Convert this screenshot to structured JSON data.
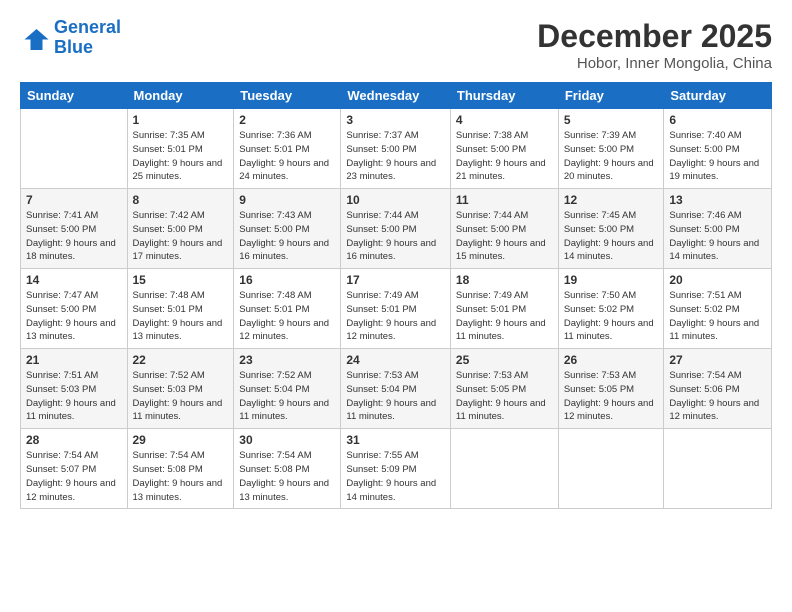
{
  "logo": {
    "line1": "General",
    "line2": "Blue"
  },
  "title": "December 2025",
  "location": "Hobor, Inner Mongolia, China",
  "header_days": [
    "Sunday",
    "Monday",
    "Tuesday",
    "Wednesday",
    "Thursday",
    "Friday",
    "Saturday"
  ],
  "weeks": [
    [
      {
        "day": "",
        "sunrise": "",
        "sunset": "",
        "daylight": ""
      },
      {
        "day": "1",
        "sunrise": "Sunrise: 7:35 AM",
        "sunset": "Sunset: 5:01 PM",
        "daylight": "Daylight: 9 hours and 25 minutes."
      },
      {
        "day": "2",
        "sunrise": "Sunrise: 7:36 AM",
        "sunset": "Sunset: 5:01 PM",
        "daylight": "Daylight: 9 hours and 24 minutes."
      },
      {
        "day": "3",
        "sunrise": "Sunrise: 7:37 AM",
        "sunset": "Sunset: 5:00 PM",
        "daylight": "Daylight: 9 hours and 23 minutes."
      },
      {
        "day": "4",
        "sunrise": "Sunrise: 7:38 AM",
        "sunset": "Sunset: 5:00 PM",
        "daylight": "Daylight: 9 hours and 21 minutes."
      },
      {
        "day": "5",
        "sunrise": "Sunrise: 7:39 AM",
        "sunset": "Sunset: 5:00 PM",
        "daylight": "Daylight: 9 hours and 20 minutes."
      },
      {
        "day": "6",
        "sunrise": "Sunrise: 7:40 AM",
        "sunset": "Sunset: 5:00 PM",
        "daylight": "Daylight: 9 hours and 19 minutes."
      }
    ],
    [
      {
        "day": "7",
        "sunrise": "Sunrise: 7:41 AM",
        "sunset": "Sunset: 5:00 PM",
        "daylight": "Daylight: 9 hours and 18 minutes."
      },
      {
        "day": "8",
        "sunrise": "Sunrise: 7:42 AM",
        "sunset": "Sunset: 5:00 PM",
        "daylight": "Daylight: 9 hours and 17 minutes."
      },
      {
        "day": "9",
        "sunrise": "Sunrise: 7:43 AM",
        "sunset": "Sunset: 5:00 PM",
        "daylight": "Daylight: 9 hours and 16 minutes."
      },
      {
        "day": "10",
        "sunrise": "Sunrise: 7:44 AM",
        "sunset": "Sunset: 5:00 PM",
        "daylight": "Daylight: 9 hours and 16 minutes."
      },
      {
        "day": "11",
        "sunrise": "Sunrise: 7:44 AM",
        "sunset": "Sunset: 5:00 PM",
        "daylight": "Daylight: 9 hours and 15 minutes."
      },
      {
        "day": "12",
        "sunrise": "Sunrise: 7:45 AM",
        "sunset": "Sunset: 5:00 PM",
        "daylight": "Daylight: 9 hours and 14 minutes."
      },
      {
        "day": "13",
        "sunrise": "Sunrise: 7:46 AM",
        "sunset": "Sunset: 5:00 PM",
        "daylight": "Daylight: 9 hours and 14 minutes."
      }
    ],
    [
      {
        "day": "14",
        "sunrise": "Sunrise: 7:47 AM",
        "sunset": "Sunset: 5:00 PM",
        "daylight": "Daylight: 9 hours and 13 minutes."
      },
      {
        "day": "15",
        "sunrise": "Sunrise: 7:48 AM",
        "sunset": "Sunset: 5:01 PM",
        "daylight": "Daylight: 9 hours and 13 minutes."
      },
      {
        "day": "16",
        "sunrise": "Sunrise: 7:48 AM",
        "sunset": "Sunset: 5:01 PM",
        "daylight": "Daylight: 9 hours and 12 minutes."
      },
      {
        "day": "17",
        "sunrise": "Sunrise: 7:49 AM",
        "sunset": "Sunset: 5:01 PM",
        "daylight": "Daylight: 9 hours and 12 minutes."
      },
      {
        "day": "18",
        "sunrise": "Sunrise: 7:49 AM",
        "sunset": "Sunset: 5:01 PM",
        "daylight": "Daylight: 9 hours and 11 minutes."
      },
      {
        "day": "19",
        "sunrise": "Sunrise: 7:50 AM",
        "sunset": "Sunset: 5:02 PM",
        "daylight": "Daylight: 9 hours and 11 minutes."
      },
      {
        "day": "20",
        "sunrise": "Sunrise: 7:51 AM",
        "sunset": "Sunset: 5:02 PM",
        "daylight": "Daylight: 9 hours and 11 minutes."
      }
    ],
    [
      {
        "day": "21",
        "sunrise": "Sunrise: 7:51 AM",
        "sunset": "Sunset: 5:03 PM",
        "daylight": "Daylight: 9 hours and 11 minutes."
      },
      {
        "day": "22",
        "sunrise": "Sunrise: 7:52 AM",
        "sunset": "Sunset: 5:03 PM",
        "daylight": "Daylight: 9 hours and 11 minutes."
      },
      {
        "day": "23",
        "sunrise": "Sunrise: 7:52 AM",
        "sunset": "Sunset: 5:04 PM",
        "daylight": "Daylight: 9 hours and 11 minutes."
      },
      {
        "day": "24",
        "sunrise": "Sunrise: 7:53 AM",
        "sunset": "Sunset: 5:04 PM",
        "daylight": "Daylight: 9 hours and 11 minutes."
      },
      {
        "day": "25",
        "sunrise": "Sunrise: 7:53 AM",
        "sunset": "Sunset: 5:05 PM",
        "daylight": "Daylight: 9 hours and 11 minutes."
      },
      {
        "day": "26",
        "sunrise": "Sunrise: 7:53 AM",
        "sunset": "Sunset: 5:05 PM",
        "daylight": "Daylight: 9 hours and 12 minutes."
      },
      {
        "day": "27",
        "sunrise": "Sunrise: 7:54 AM",
        "sunset": "Sunset: 5:06 PM",
        "daylight": "Daylight: 9 hours and 12 minutes."
      }
    ],
    [
      {
        "day": "28",
        "sunrise": "Sunrise: 7:54 AM",
        "sunset": "Sunset: 5:07 PM",
        "daylight": "Daylight: 9 hours and 12 minutes."
      },
      {
        "day": "29",
        "sunrise": "Sunrise: 7:54 AM",
        "sunset": "Sunset: 5:08 PM",
        "daylight": "Daylight: 9 hours and 13 minutes."
      },
      {
        "day": "30",
        "sunrise": "Sunrise: 7:54 AM",
        "sunset": "Sunset: 5:08 PM",
        "daylight": "Daylight: 9 hours and 13 minutes."
      },
      {
        "day": "31",
        "sunrise": "Sunrise: 7:55 AM",
        "sunset": "Sunset: 5:09 PM",
        "daylight": "Daylight: 9 hours and 14 minutes."
      },
      {
        "day": "",
        "sunrise": "",
        "sunset": "",
        "daylight": ""
      },
      {
        "day": "",
        "sunrise": "",
        "sunset": "",
        "daylight": ""
      },
      {
        "day": "",
        "sunrise": "",
        "sunset": "",
        "daylight": ""
      }
    ]
  ]
}
